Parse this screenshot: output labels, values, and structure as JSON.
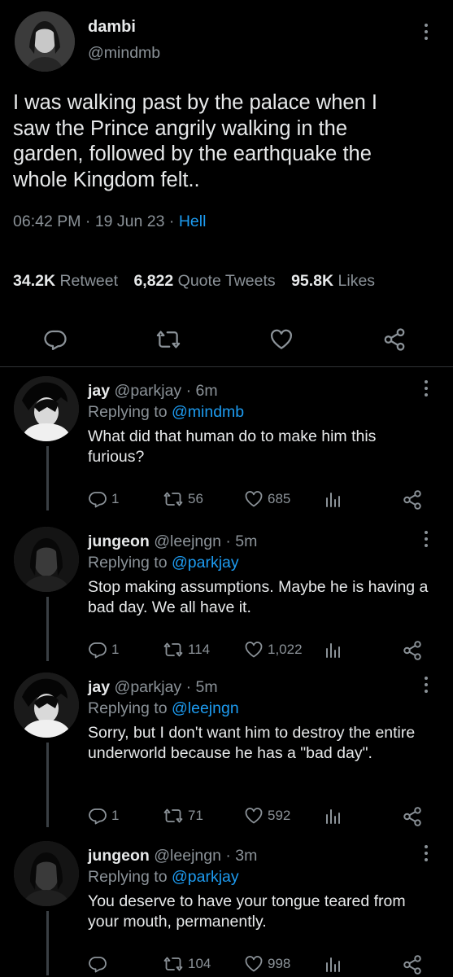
{
  "tweet": {
    "author_name": "dambi",
    "author_handle": "@mindmb",
    "text": "I was walking past by the palace when I saw the Prince angrily walking in the garden, followed by the earthquake the whole Kingdom felt..",
    "time": "06:42 PM",
    "date": "19 Jun 23",
    "source": "Hell",
    "stats": {
      "retweets_count": "34.2K",
      "retweets_label": "Retweet",
      "quotes_count": "6,822",
      "quotes_label": "Quote Tweets",
      "likes_count": "95.8K",
      "likes_label": "Likes"
    }
  },
  "replies": [
    {
      "name": "jay",
      "handle": "@parkjay",
      "age": "6m",
      "replying_prefix": "Replying to",
      "replying_to": "@mindmb",
      "text": "What did that human do to make him this furious?",
      "reply_count": "1",
      "retweet_count": "56",
      "like_count": "685"
    },
    {
      "name": "jungeon",
      "handle": "@leejngn",
      "age": "5m",
      "replying_prefix": "Replying to",
      "replying_to": "@parkjay",
      "text": "Stop making assumptions. Maybe he is having a bad day. We all have it.",
      "reply_count": "1",
      "retweet_count": "114",
      "like_count": "1,022"
    },
    {
      "name": "jay",
      "handle": "@parkjay",
      "age": "5m",
      "replying_prefix": "Replying to",
      "replying_to": "@leejngn",
      "text": "Sorry, but I don't want him to destroy the entire underworld because he has a \"bad day\".",
      "reply_count": "1",
      "retweet_count": "71",
      "like_count": "592"
    },
    {
      "name": "jungeon",
      "handle": "@leejngn",
      "age": "3m",
      "replying_prefix": "Replying to",
      "replying_to": "@parkjay",
      "text": "You deserve to have your tongue teared from your mouth, permanently.",
      "reply_count": "",
      "retweet_count": "104",
      "like_count": "998"
    }
  ],
  "icons": {
    "reply": "reply-icon",
    "retweet": "retweet-icon",
    "like": "heart-icon",
    "share": "share-icon",
    "views": "analytics-icon",
    "more": "more-icon"
  },
  "colors": {
    "background": "#000000",
    "text": "#e7e9ea",
    "muted": "#8b9298",
    "link": "#1d9bf0",
    "thread": "#3a3f44"
  }
}
